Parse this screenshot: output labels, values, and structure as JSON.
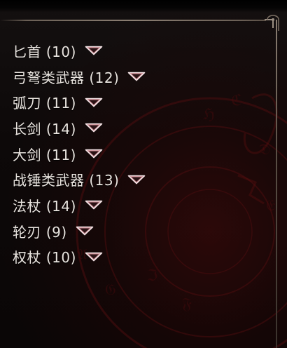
{
  "weapon_list": {
    "items": [
      {
        "label": "匕首 (10)",
        "icon": "dropdown-caret-icon"
      },
      {
        "label": "弓弩类武器 (12)",
        "icon": "dropdown-caret-icon"
      },
      {
        "label": "弧刀 (11)",
        "icon": "dropdown-caret-icon"
      },
      {
        "label": "长剑 (14)",
        "icon": "dropdown-caret-icon"
      },
      {
        "label": "大剑 (11)",
        "icon": "dropdown-caret-icon"
      },
      {
        "label": "战锤类武器 (13)",
        "icon": "dropdown-caret-icon"
      },
      {
        "label": "法杖 (14)",
        "icon": "dropdown-caret-icon"
      },
      {
        "label": "轮刃 (9)",
        "icon": "dropdown-caret-icon"
      },
      {
        "label": "权杖 (10)",
        "icon": "dropdown-caret-icon"
      }
    ]
  },
  "colors": {
    "text": "#e9e4df",
    "caret_fill": "#c9878f",
    "caret_stroke": "#f3e3e5",
    "frame": "#8a7e72",
    "background": "#0b0707",
    "sigil": "#5a0e10"
  }
}
